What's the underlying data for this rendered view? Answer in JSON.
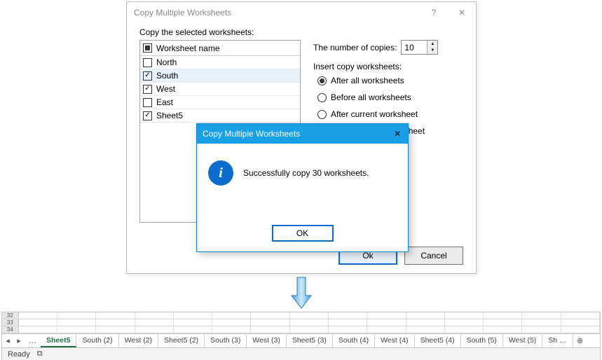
{
  "dialog": {
    "title": "Copy Multiple Worksheets",
    "help_glyph": "?",
    "close_glyph": "✕",
    "instruction": "Copy the selected worksheets:",
    "header_label": "Worksheet name",
    "rows": [
      {
        "label": "North",
        "checked": false
      },
      {
        "label": "South",
        "checked": true,
        "selected": true
      },
      {
        "label": "West",
        "checked": true
      },
      {
        "label": "East",
        "checked": false
      },
      {
        "label": "Sheet5",
        "checked": true
      }
    ],
    "copies_label": "The number of copies:",
    "copies_value": "10",
    "insert_label": "Insert copy worksheets:",
    "radios": [
      {
        "label": "After all worksheets",
        "checked": true
      },
      {
        "label": "Before all worksheets",
        "checked": false
      },
      {
        "label": "After current worksheet",
        "checked": false,
        "obscured_text": "ent worksheet"
      },
      {
        "label": "Before current worksheet",
        "checked": false,
        "obscured_text": "rrent worksheet"
      }
    ],
    "ok": "Ok",
    "cancel": "Cancel"
  },
  "msgbox": {
    "title": "Copy Multiple Worksheets",
    "close_glyph": "✕",
    "info_glyph": "i",
    "message": "Successfully copy 30 worksheets.",
    "ok": "OK"
  },
  "excel": {
    "row_numbers": [
      "32",
      "33",
      "34"
    ],
    "nav_prev": "◂",
    "nav_next": "▸",
    "ellipsis": "…",
    "tabs": [
      {
        "label": "Sheet5",
        "active": true
      },
      {
        "label": "South (2)"
      },
      {
        "label": "West (2)"
      },
      {
        "label": "Sheet5 (2)"
      },
      {
        "label": "South (3)"
      },
      {
        "label": "West (3)"
      },
      {
        "label": "Sheet5 (3)"
      },
      {
        "label": "South (4)"
      },
      {
        "label": "West (4)"
      },
      {
        "label": "Sheet5 (4)"
      },
      {
        "label": "South (5)"
      },
      {
        "label": "West (5)"
      },
      {
        "label": "Sh …"
      }
    ],
    "plus_glyph": "⊕",
    "status": "Ready",
    "record_glyph": "⧉"
  }
}
